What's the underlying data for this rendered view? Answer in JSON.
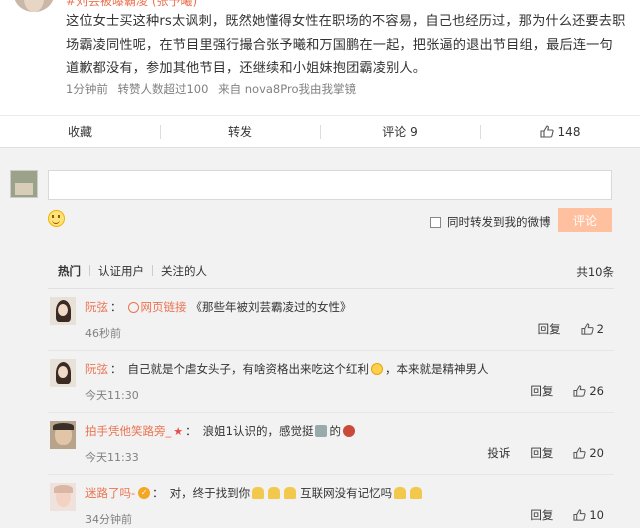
{
  "post": {
    "cut_line": "#刘芸被曝霸凌 (张予曦)",
    "text": "这位女士买这种rs太讽刺，既然她懂得女性在职场的不容易，自己也经历过，那为什么还要去职场霸凌同性呢，在节目里强行撮合张予曦和万国鹏在一起，把张逼的退出节目组，最后连一句道歉都没有，参加其他节目，还继续和小姐妹抱团霸凌别人。",
    "meta_time": "1分钟前",
    "meta_forward": "转赞人数超过100",
    "meta_source": "来自 nova8Pro我由我掌镜"
  },
  "actions": {
    "collect": "收藏",
    "forward": "转发",
    "comment": "评论 9",
    "like": "148"
  },
  "composer": {
    "forward_label": "同时转发到我的微博",
    "submit_label": "评论"
  },
  "list": {
    "tab_hot": "热门",
    "tab_verified": "认证用户",
    "tab_following": "关注的人",
    "total": "共10条"
  },
  "comments": [
    {
      "user": "阮弦",
      "link_label": "网页链接",
      "text": "《那些年被刘芸霸凌过的女性》",
      "time": "46秒前",
      "reply": "回复",
      "likes": "2"
    },
    {
      "user": "阮弦",
      "text_a": "自己就是个虐女头子，有啥资格出来吃这个红利",
      "text_b": "，本来就是精神男人",
      "time": "今天11:30",
      "reply": "回复",
      "likes": "26"
    },
    {
      "user": "拍手凭他笑路旁_",
      "text_a": "浪姐1认识的，感觉挺",
      "text_b": "的",
      "time": "今天11:33",
      "report": "投诉",
      "reply": "回复",
      "likes": "20"
    },
    {
      "user": "迷路了吗-",
      "text_a": "对，终于找到你",
      "text_b": "互联网没有记忆吗",
      "time": "34分钟前",
      "reply": "回复",
      "likes": "10"
    }
  ],
  "colors": {
    "accent": "#eb7350",
    "submit_bg": "#ffc09f",
    "muted": "#808080"
  }
}
